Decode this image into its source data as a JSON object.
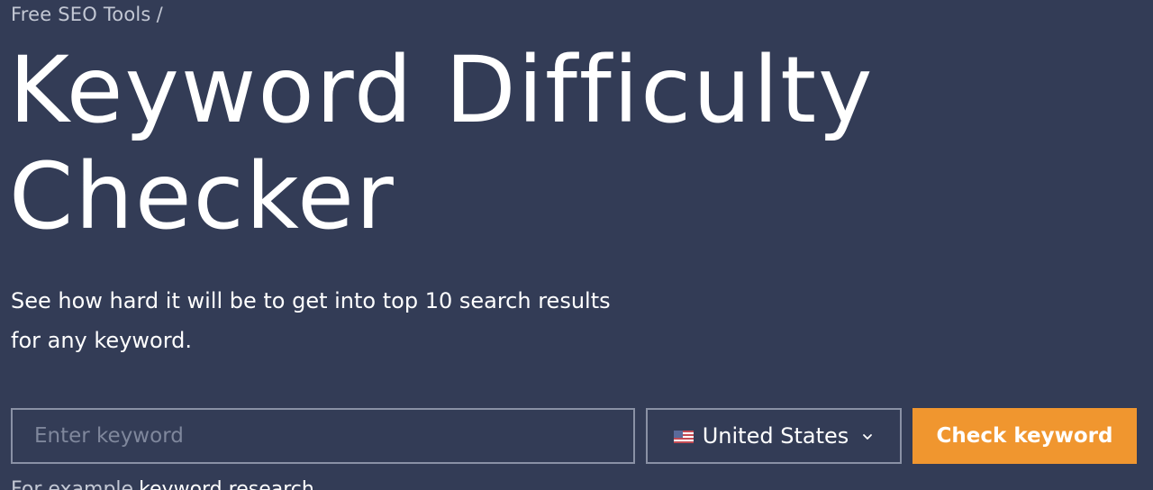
{
  "breadcrumb": {
    "label": "Free SEO Tools",
    "separator": "/"
  },
  "hero": {
    "title_line1": "Keyword Difficulty",
    "title_line2": "Checker",
    "subtitle_line1": "See how hard it will be to get into top 10 search results",
    "subtitle_line2": "for any keyword."
  },
  "form": {
    "keyword_placeholder": "Enter keyword",
    "keyword_value": "",
    "country_selected": "United States",
    "country_icon": "us-flag-icon",
    "submit_label": "Check keyword"
  },
  "example": {
    "prefix": "For example",
    "link": "keyword research"
  },
  "colors": {
    "background": "#333c56",
    "accent": "#f0962f",
    "border": "#8a91a5",
    "muted_text": "#c3c8d4"
  }
}
